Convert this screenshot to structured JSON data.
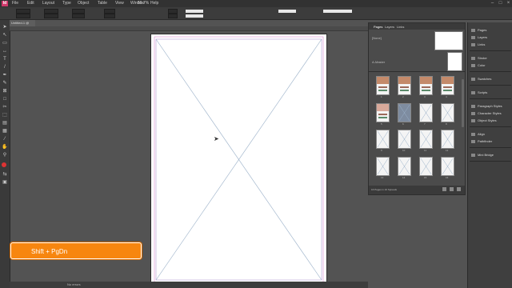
{
  "app": {
    "logo": "Id"
  },
  "menubar": {
    "items": [
      "File",
      "Edit",
      "Layout",
      "Type",
      "Object",
      "Table",
      "View",
      "Window",
      "Help"
    ],
    "zoom": "56.7%"
  },
  "document": {
    "tab_title": "Untitled-1 @ 56%"
  },
  "pages_panel": {
    "tabs": [
      "Pages",
      "Layers",
      "Links"
    ],
    "master_none": "[None]",
    "master_a": "A-Master",
    "footer": "16 Pages in 16 Spreads",
    "thumb_labels": [
      "1",
      "2",
      "3",
      "4",
      "5",
      "6",
      "7",
      "8",
      "9",
      "10",
      "11",
      "12",
      "13",
      "14",
      "15",
      "16"
    ]
  },
  "dock": {
    "groups": [
      [
        "Pages",
        "Layers",
        "Links"
      ],
      [
        "Stroke",
        "Color"
      ],
      [
        "Swatches"
      ],
      [
        "Scripts"
      ],
      [
        "Paragraph Styles",
        "Character Styles",
        "Object Styles"
      ],
      [
        "Align",
        "Pathfinder"
      ],
      [
        "Mini Bridge"
      ]
    ]
  },
  "statusbar": {
    "status": "No errors"
  },
  "shortcut": {
    "label": "Shift + PgDn"
  },
  "colors": {
    "shortcut_bg": "#f7860f",
    "app_accent": "#d0396b"
  }
}
